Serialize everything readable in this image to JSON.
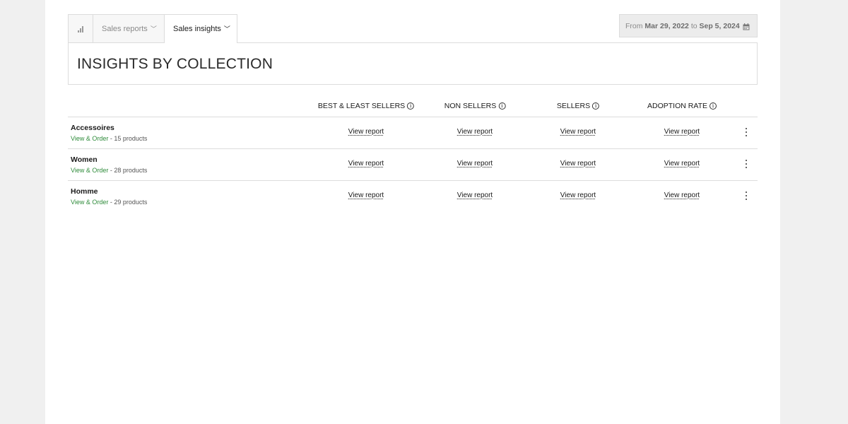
{
  "tabs": {
    "stats_icon": "bar-chart-icon",
    "reports_label": "Sales reports",
    "insights_label": "Sales insights"
  },
  "date_range": {
    "from_label": "From",
    "from_date": "Mar 29, 2022",
    "to_label": "to",
    "to_date": "Sep 5, 2024",
    "icon": "calendar-icon"
  },
  "page_title": "INSIGHTS BY COLLECTION",
  "columns": [
    "BEST & LEAST SELLERS",
    "NON SELLERS",
    "SELLERS",
    "ADOPTION RATE"
  ],
  "rows": [
    {
      "name": "Accessoires",
      "type": "View & Order",
      "count": " - 15 products",
      "links": [
        "View report",
        "View report",
        "View report",
        "View report"
      ]
    },
    {
      "name": "Women",
      "type": "View & Order",
      "count": " - 28 products",
      "links": [
        "View report",
        "View report",
        "View report",
        "View report"
      ]
    },
    {
      "name": "Homme",
      "type": "View & Order",
      "count": " - 29 products",
      "links": [
        "View report",
        "View report",
        "View report",
        "View report"
      ]
    }
  ],
  "colors": {
    "accent_green": "#2e8b3a",
    "border": "#dcdcdc",
    "page_bg": "#f0f0f0"
  }
}
